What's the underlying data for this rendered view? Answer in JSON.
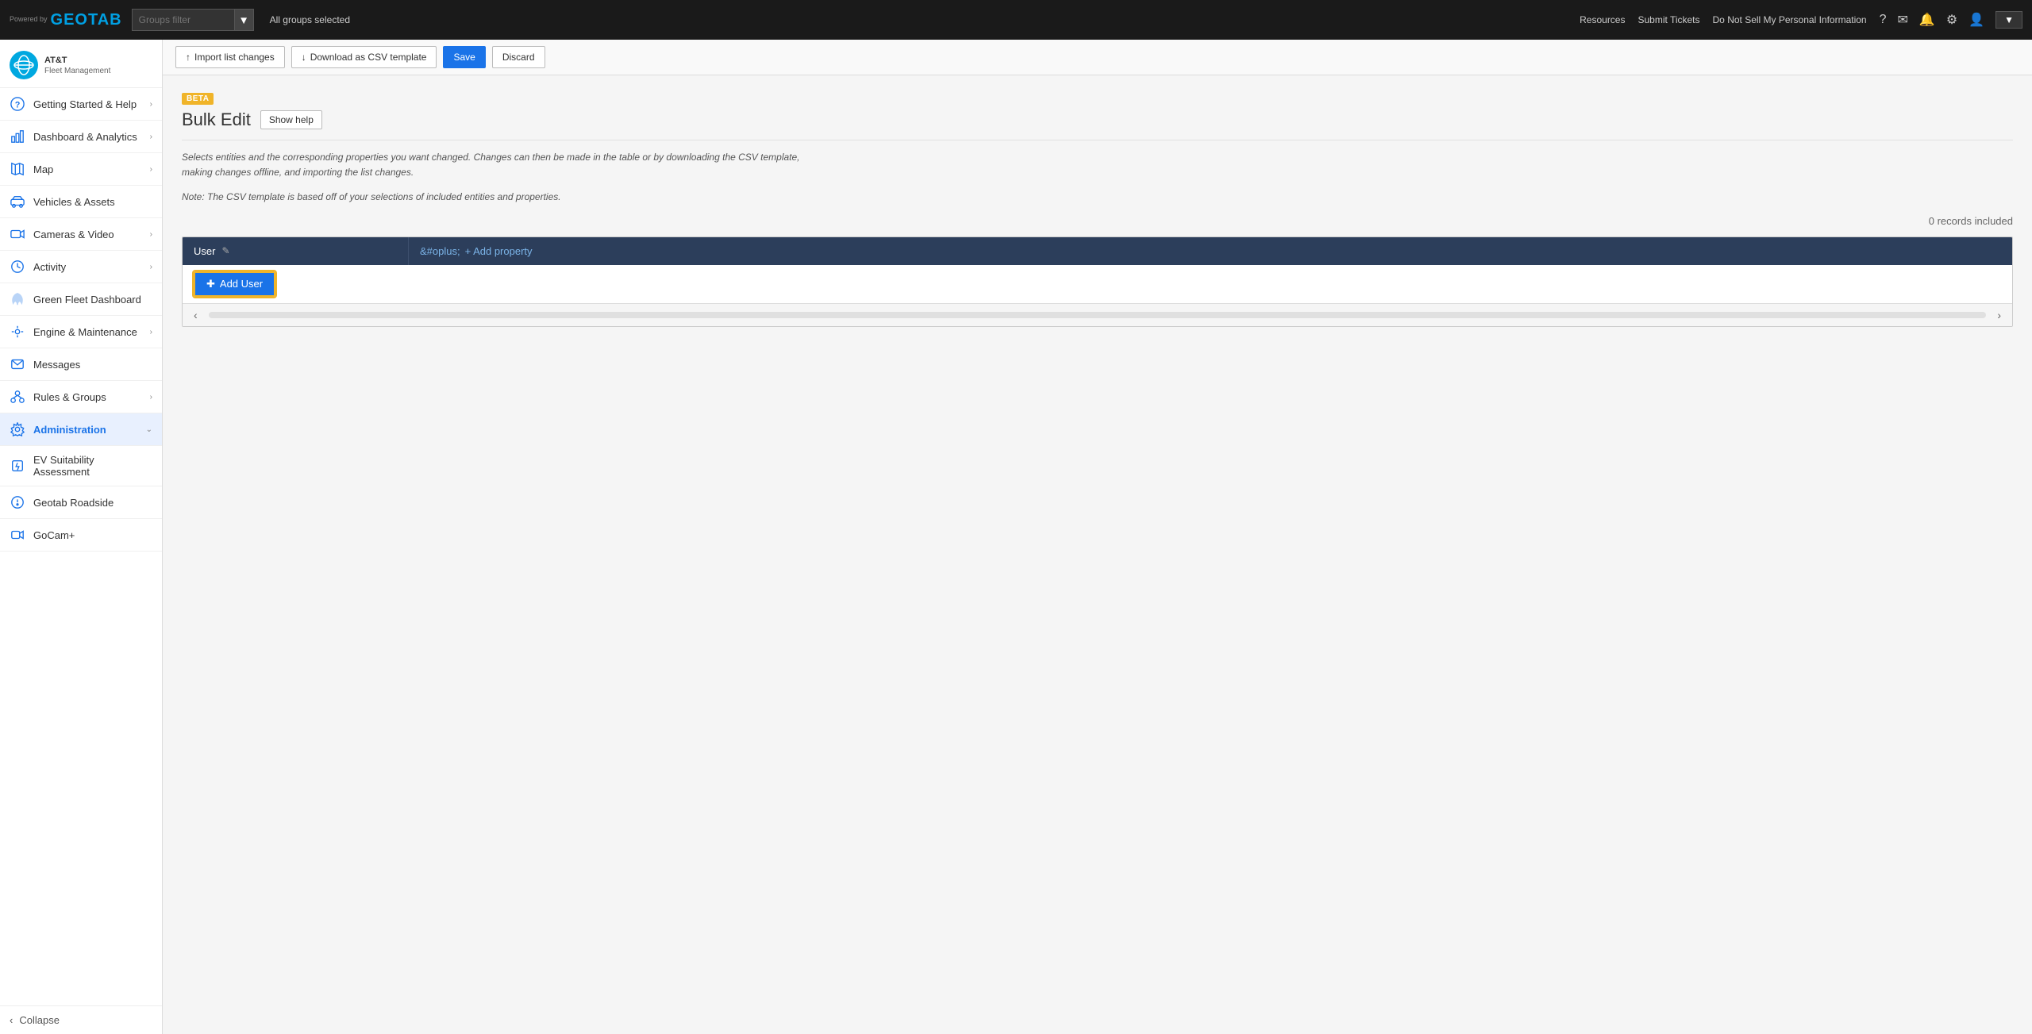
{
  "topbar": {
    "powered_by": "Powered by",
    "brand": "GEOTAB",
    "groups_filter_label": "Groups filter",
    "groups_selected": "All groups selected",
    "links": [
      "Resources",
      "Submit Tickets",
      "Do Not Sell My Personal Information"
    ]
  },
  "sidebar": {
    "logo_abbr": "AT&T",
    "logo_line1": "AT&T",
    "logo_line2": "Fleet Management",
    "nav_items": [
      {
        "id": "getting-started",
        "label": "Getting Started & Help",
        "icon": "question-circle",
        "has_children": true
      },
      {
        "id": "dashboard",
        "label": "Dashboard & Analytics",
        "icon": "chart-bar",
        "has_children": true
      },
      {
        "id": "map",
        "label": "Map",
        "icon": "map",
        "has_children": true
      },
      {
        "id": "vehicles",
        "label": "Vehicles & Assets",
        "icon": "truck",
        "has_children": false
      },
      {
        "id": "cameras",
        "label": "Cameras & Video",
        "icon": "video",
        "has_children": true
      },
      {
        "id": "activity",
        "label": "Activity",
        "icon": "clock",
        "has_children": true
      },
      {
        "id": "green-fleet",
        "label": "Green Fleet Dashboard",
        "icon": "leaf",
        "has_children": false
      },
      {
        "id": "engine",
        "label": "Engine & Maintenance",
        "icon": "wrench",
        "has_children": true
      },
      {
        "id": "messages",
        "label": "Messages",
        "icon": "envelope",
        "has_children": false
      },
      {
        "id": "rules",
        "label": "Rules & Groups",
        "icon": "rules",
        "has_children": true
      },
      {
        "id": "administration",
        "label": "Administration",
        "icon": "gear",
        "has_children": true,
        "active": true
      },
      {
        "id": "ev-suitability",
        "label": "EV Suitability Assessment",
        "icon": "ev",
        "has_children": false
      },
      {
        "id": "geotab-roadside",
        "label": "Geotab Roadside",
        "icon": "roadside",
        "has_children": false
      },
      {
        "id": "gocam",
        "label": "GoCam+",
        "icon": "camera",
        "has_children": false
      }
    ],
    "collapse_label": "Collapse"
  },
  "toolbar": {
    "import_label": "Import list changes",
    "download_label": "Download as CSV template",
    "save_label": "Save",
    "discard_label": "Discard"
  },
  "page": {
    "beta_label": "BETA",
    "title": "Bulk Edit",
    "show_help_label": "Show help",
    "description_line1": "Selects entities and the corresponding properties you want changed. Changes can then be made in the table or by downloading the CSV template, making changes offline, and importing the list changes.",
    "description_line2": "Note: The CSV template is based off of your selections of included entities and properties.",
    "records_count": "0 records included",
    "table": {
      "col_user": "User",
      "col_add_property": "+ Add property",
      "add_user_label": "Add User",
      "add_user_icon": "+"
    }
  }
}
